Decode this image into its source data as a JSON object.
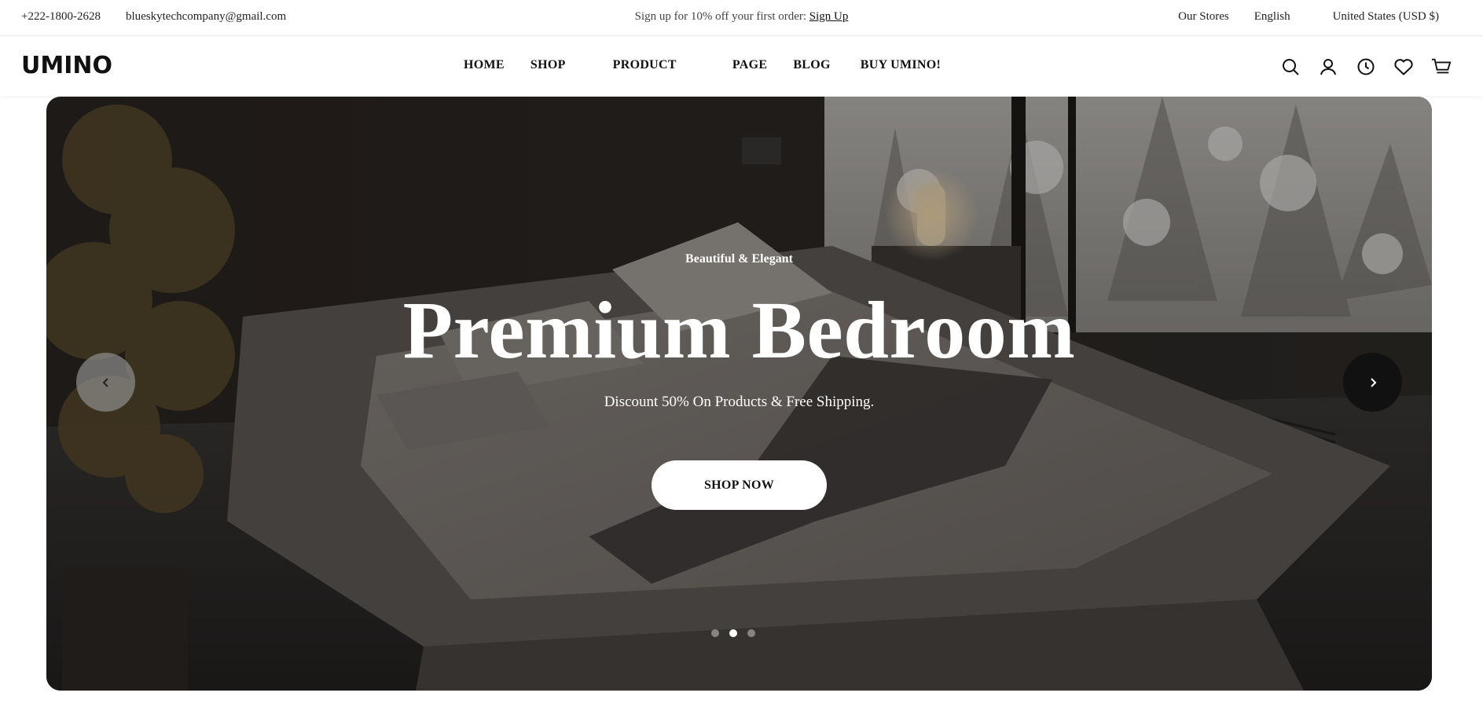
{
  "topbar": {
    "phone": "+222-1800-2628",
    "email": "blueskytechcompany@gmail.com",
    "promo_text": "Sign up for 10% off your first order: ",
    "promo_link": "Sign Up",
    "stores": "Our Stores",
    "language": "English",
    "currency": "United States (USD $)"
  },
  "header": {
    "logo": "UMINO",
    "nav": [
      "HOME",
      "SHOP",
      "PRODUCT",
      "PAGE",
      "BLOG",
      "BUY UMINO!"
    ],
    "icons": [
      "search-icon",
      "account-icon",
      "history-icon",
      "wishlist-icon",
      "cart-icon"
    ]
  },
  "hero": {
    "eyebrow": "Beautiful & Elegant",
    "title": "Premium Bedroom",
    "subtitle": "Discount 50% On Products & Free Shipping.",
    "cta": "SHOP NOW",
    "slides": 3,
    "active_slide": 2
  },
  "colors": {
    "text": "#111111",
    "cta_bg": "#ffffff",
    "next_arrow_bg": "#111111"
  }
}
